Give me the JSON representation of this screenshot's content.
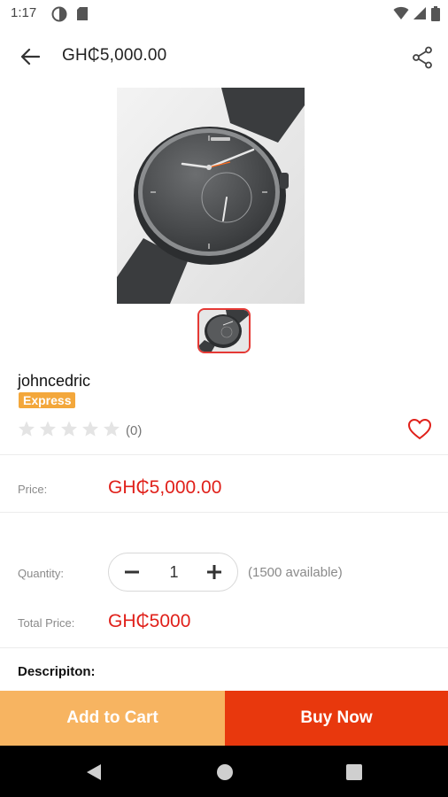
{
  "status_bar": {
    "time": "1:17",
    "icons": [
      "data-saver-icon",
      "sd-card-icon",
      "wifi-icon",
      "signal-icon",
      "battery-icon"
    ]
  },
  "header": {
    "title": "GH₵5,000.00",
    "back_icon": "arrow-back-icon",
    "share_icon": "share-icon"
  },
  "product": {
    "image": "watch-image",
    "thumbnail": "watch-thumbnail"
  },
  "seller": {
    "name": "johncedric",
    "badge": "Express",
    "rating": 0,
    "max_rating": 5,
    "review_count": "(0)"
  },
  "price": {
    "label": "Price:",
    "value": "GH₵5,000.00"
  },
  "quantity": {
    "label": "Quantity:",
    "value": "1",
    "available": "(1500 available)"
  },
  "total": {
    "label": "Total Price:",
    "value": "GH₵5000"
  },
  "description": {
    "label": "Descripiton:"
  },
  "actions": {
    "add_to_cart": "Add to Cart",
    "buy_now": "Buy Now"
  },
  "colors": {
    "accent_red": "#e0201a",
    "buy_button": "#e8380d",
    "cart_button": "#f7b461",
    "badge": "#f3a73b"
  }
}
